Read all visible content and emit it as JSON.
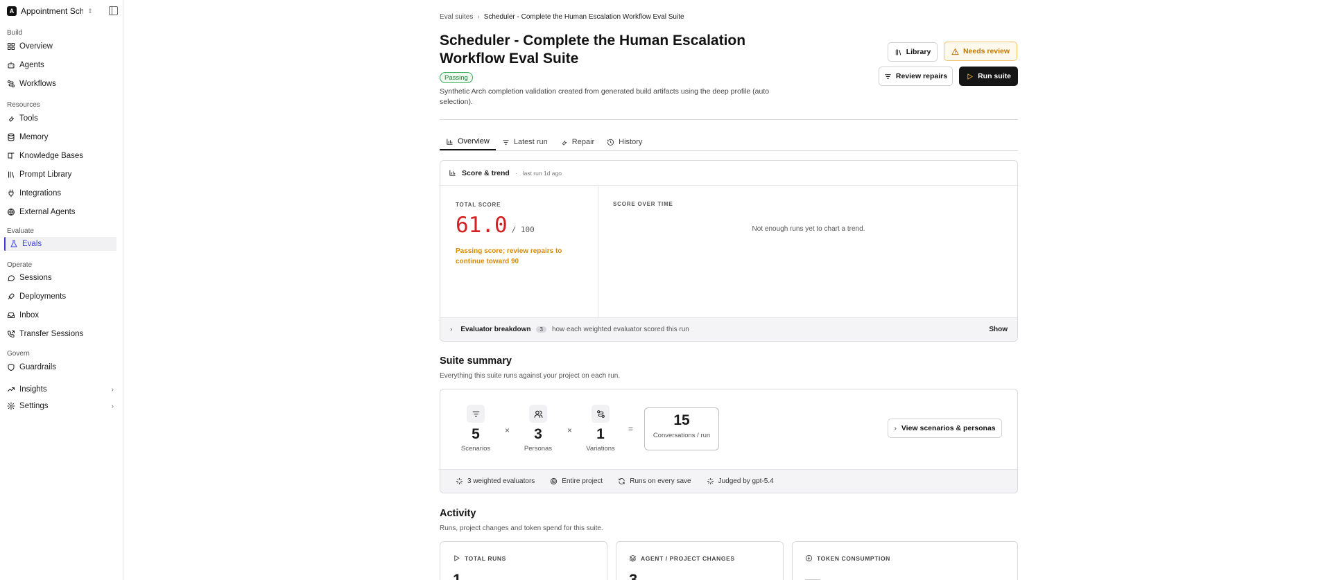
{
  "workspace": {
    "logo": "A",
    "name": "Appointment Sch..."
  },
  "sidebar": {
    "sections": [
      {
        "label": "Build"
      },
      {
        "label": "Resources"
      },
      {
        "label": "Evaluate"
      },
      {
        "label": "Operate"
      },
      {
        "label": "Govern"
      }
    ],
    "items": [
      {
        "label": "Overview",
        "icon": "layout-grid-icon"
      },
      {
        "label": "Agents",
        "icon": "bot-icon"
      },
      {
        "label": "Workflows",
        "icon": "workflow-icon"
      },
      {
        "label": "Tools",
        "icon": "wrench-icon"
      },
      {
        "label": "Memory",
        "icon": "database-icon"
      },
      {
        "label": "Knowledge Bases",
        "icon": "book-icon"
      },
      {
        "label": "Prompt Library",
        "icon": "library-icon"
      },
      {
        "label": "Integrations",
        "icon": "plug-icon"
      },
      {
        "label": "External Agents",
        "icon": "globe-icon"
      },
      {
        "label": "Evals",
        "icon": "flask-icon",
        "active": true
      },
      {
        "label": "Sessions",
        "icon": "message-icon"
      },
      {
        "label": "Deployments",
        "icon": "rocket-icon"
      },
      {
        "label": "Inbox",
        "icon": "inbox-icon"
      },
      {
        "label": "Transfer Sessions",
        "icon": "phone-forward-icon"
      },
      {
        "label": "Guardrails",
        "icon": "shield-icon"
      },
      {
        "label": "Insights",
        "icon": "trend-icon"
      },
      {
        "label": "Settings",
        "icon": "gear-icon"
      }
    ],
    "accent": "#3b3fd8"
  },
  "breadcrumb": {
    "parent": "Eval suites",
    "current": "Scheduler - Complete the Human Escalation Workflow Eval Suite"
  },
  "page": {
    "title": "Scheduler - Complete the Human Escalation Workflow Eval Suite",
    "status": "Passing",
    "description": "Synthetic Arch completion validation created from generated build artifacts using the deep profile (auto selection).",
    "buttons": {
      "library": "Library",
      "needs_review": "Needs review",
      "review_repairs": "Review repairs",
      "run_suite": "Run suite"
    }
  },
  "tabs": [
    {
      "label": "Overview",
      "icon": "bar-chart-icon",
      "active": true
    },
    {
      "label": "Latest run",
      "icon": "filter-icon"
    },
    {
      "label": "Repair",
      "icon": "wrench-icon"
    },
    {
      "label": "History",
      "icon": "history-icon"
    }
  ],
  "score": {
    "heading": "Score & trend",
    "last_run": "last run 1d ago",
    "total_label": "TOTAL SCORE",
    "value": "61.0",
    "out_of": "/ 100",
    "note": "Passing score; review repairs to continue toward 90",
    "trend_label": "SCORE OVER TIME",
    "trend_empty": "Not enough runs yet to chart a trend.",
    "breakdown_label": "Evaluator breakdown",
    "breakdown_count": "3",
    "breakdown_desc": "how each weighted evaluator scored this run",
    "breakdown_action": "Show",
    "score_color": "#d42020",
    "note_color": "#d98a00"
  },
  "summary": {
    "title": "Suite summary",
    "subtitle": "Everything this suite runs against your project on each run.",
    "scenarios": {
      "value": "5",
      "label": "Scenarios"
    },
    "personas": {
      "value": "3",
      "label": "Personas"
    },
    "variations": {
      "value": "1",
      "label": "Variations"
    },
    "times": "×",
    "equals": "=",
    "total": {
      "value": "15",
      "label": "Conversations / run"
    },
    "view_button": "View scenarios & personas",
    "footer": [
      "3 weighted evaluators",
      "Entire project",
      "Runs on every save",
      "Judged by gpt-5.4"
    ]
  },
  "activity": {
    "title": "Activity",
    "subtitle": "Runs, project changes and token spend for this suite.",
    "cards": [
      {
        "label": "TOTAL RUNS",
        "value": "1"
      },
      {
        "label": "AGENT / PROJECT CHANGES",
        "value": "3"
      },
      {
        "label": "TOKEN CONSUMPTION",
        "value": "—"
      }
    ]
  }
}
